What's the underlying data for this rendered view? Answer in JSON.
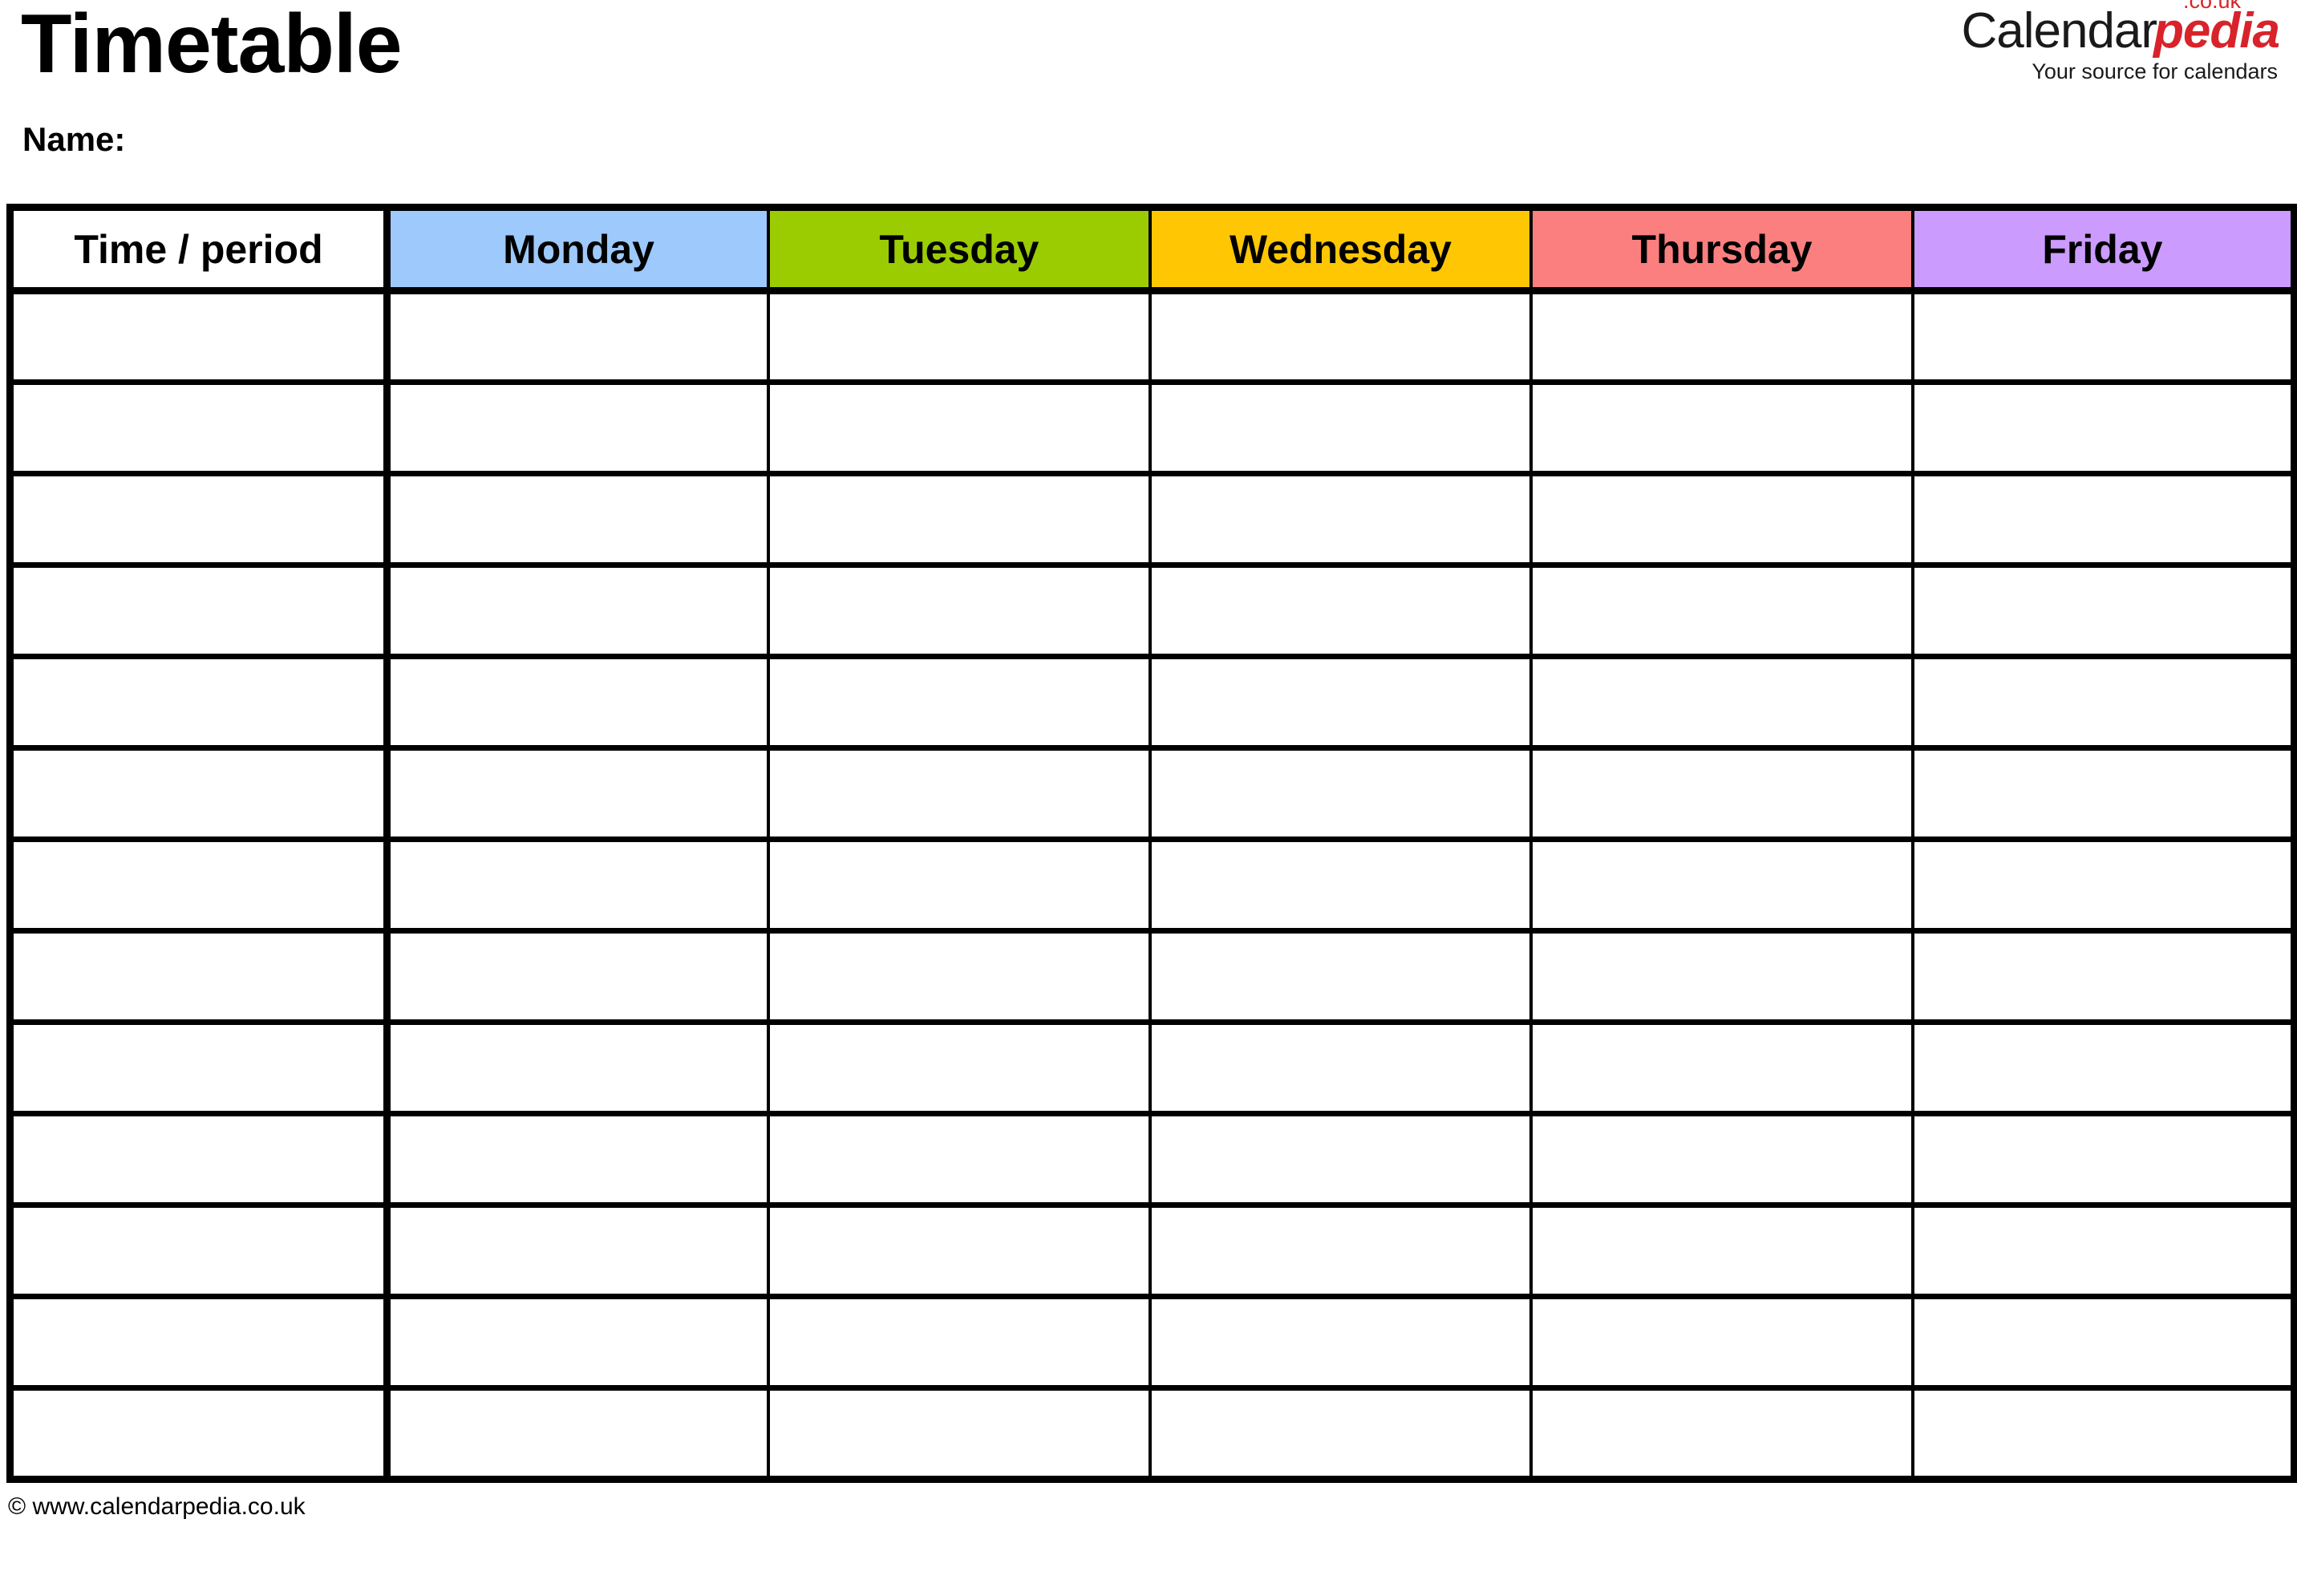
{
  "header": {
    "title": "Timetable",
    "name_label": "Name:"
  },
  "logo": {
    "brand_primary": "Calendar",
    "brand_secondary": "pedia",
    "tld": ".co.uk",
    "tagline": "Your source for calendars",
    "brand_secondary_color": "#d8232a",
    "brand_primary_color": "#1a1a1a"
  },
  "table": {
    "columns": [
      {
        "key": "time",
        "label": "Time / period",
        "background": "#ffffff"
      },
      {
        "key": "mon",
        "label": "Monday",
        "background": "#9dc9fc"
      },
      {
        "key": "tue",
        "label": "Tuesday",
        "background": "#9bcc02"
      },
      {
        "key": "wed",
        "label": "Wednesday",
        "background": "#ffc703"
      },
      {
        "key": "thu",
        "label": "Thursday",
        "background": "#fc7f80"
      },
      {
        "key": "fri",
        "label": "Friday",
        "background": "#cb9bfd"
      }
    ],
    "row_count": 13,
    "rows": [
      {
        "time": "",
        "mon": "",
        "tue": "",
        "wed": "",
        "thu": "",
        "fri": ""
      },
      {
        "time": "",
        "mon": "",
        "tue": "",
        "wed": "",
        "thu": "",
        "fri": ""
      },
      {
        "time": "",
        "mon": "",
        "tue": "",
        "wed": "",
        "thu": "",
        "fri": ""
      },
      {
        "time": "",
        "mon": "",
        "tue": "",
        "wed": "",
        "thu": "",
        "fri": ""
      },
      {
        "time": "",
        "mon": "",
        "tue": "",
        "wed": "",
        "thu": "",
        "fri": ""
      },
      {
        "time": "",
        "mon": "",
        "tue": "",
        "wed": "",
        "thu": "",
        "fri": ""
      },
      {
        "time": "",
        "mon": "",
        "tue": "",
        "wed": "",
        "thu": "",
        "fri": ""
      },
      {
        "time": "",
        "mon": "",
        "tue": "",
        "wed": "",
        "thu": "",
        "fri": ""
      },
      {
        "time": "",
        "mon": "",
        "tue": "",
        "wed": "",
        "thu": "",
        "fri": ""
      },
      {
        "time": "",
        "mon": "",
        "tue": "",
        "wed": "",
        "thu": "",
        "fri": ""
      },
      {
        "time": "",
        "mon": "",
        "tue": "",
        "wed": "",
        "thu": "",
        "fri": ""
      },
      {
        "time": "",
        "mon": "",
        "tue": "",
        "wed": "",
        "thu": "",
        "fri": ""
      },
      {
        "time": "",
        "mon": "",
        "tue": "",
        "wed": "",
        "thu": "",
        "fri": ""
      }
    ]
  },
  "footer": {
    "copyright": "© www.calendarpedia.co.uk"
  }
}
